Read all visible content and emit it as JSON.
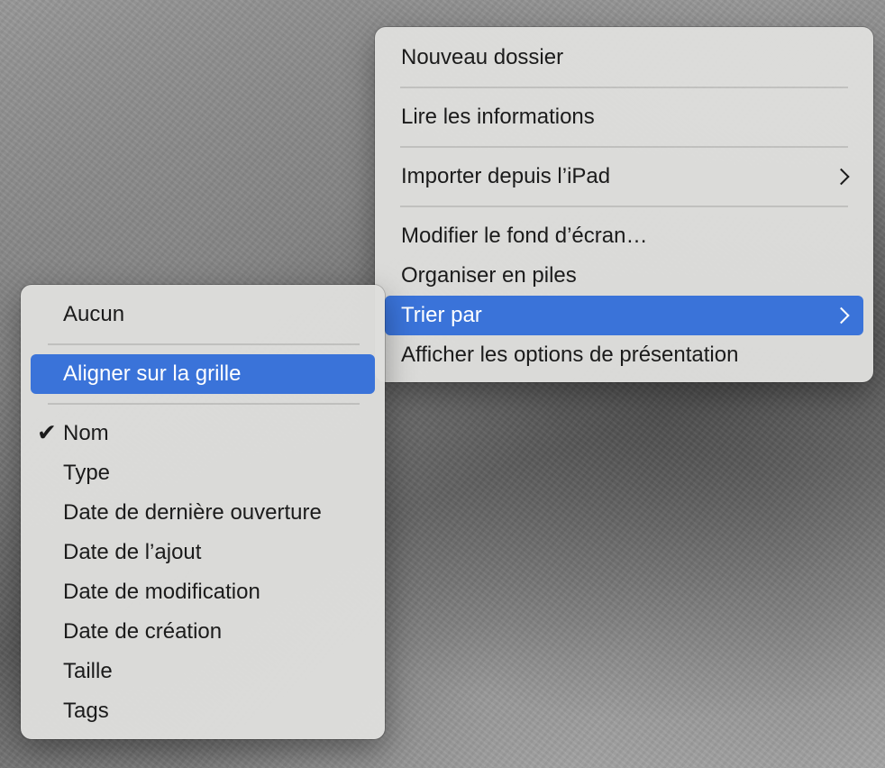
{
  "desktop": {
    "wallpaper": "grey textured wallpaper"
  },
  "context_menu": {
    "items": [
      {
        "label": "Nouveau dossier"
      },
      {
        "label": "Lire les informations"
      },
      {
        "label": "Importer depuis l’iPad",
        "submenu": true
      },
      {
        "label": "Modifier le fond d’écran…"
      },
      {
        "label": "Organiser en piles"
      },
      {
        "label": "Trier par",
        "submenu": true,
        "highlighted": true
      },
      {
        "label": "Afficher les options de présentation"
      }
    ]
  },
  "sort_submenu": {
    "items": [
      {
        "label": "Aucun"
      },
      {
        "label": "Aligner sur la grille",
        "highlighted": true
      },
      {
        "label": "Nom",
        "checked": true
      },
      {
        "label": "Type"
      },
      {
        "label": "Date de dernière ouverture"
      },
      {
        "label": "Date de l’ajout"
      },
      {
        "label": "Date de modification"
      },
      {
        "label": "Date de création"
      },
      {
        "label": "Taille"
      },
      {
        "label": "Tags"
      }
    ]
  },
  "colors": {
    "highlight": "#3a73d9",
    "menu_background": "#dededc",
    "text": "#1b1b1b"
  },
  "icons": {
    "submenu_indicator": "chevron-right-icon",
    "check": "checkmark-icon"
  }
}
